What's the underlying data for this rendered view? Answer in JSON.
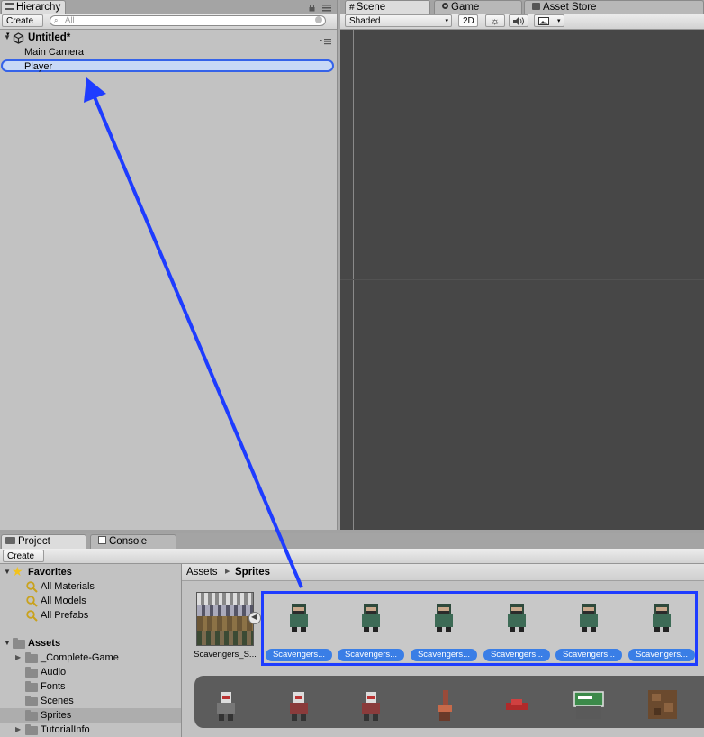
{
  "hierarchy": {
    "tab_label": "Hierarchy",
    "create_label": "Create",
    "search_placeholder": "All",
    "scene_name": "Untitled*",
    "items": [
      "Main Camera",
      "Player"
    ]
  },
  "scene_view": {
    "tabs": [
      "Scene",
      "Game",
      "Asset Store"
    ],
    "shading_mode": "Shaded",
    "mode_2d": "2D"
  },
  "project": {
    "tabs": [
      "Project",
      "Console"
    ],
    "create_label": "Create",
    "favorites_label": "Favorites",
    "favorites": [
      "All Materials",
      "All Models",
      "All Prefabs"
    ],
    "assets_label": "Assets",
    "folders": [
      "_Complete-Game",
      "Audio",
      "Fonts",
      "Scenes",
      "Sprites",
      "TutorialInfo"
    ],
    "breadcrumb": [
      "Assets",
      "Sprites"
    ],
    "sheet_label": "Scavengers_S...",
    "sprite_labels": [
      "Scavengers...",
      "Scavengers...",
      "Scavengers...",
      "Scavengers...",
      "Scavengers...",
      "Scavengers..."
    ]
  },
  "colors": {
    "annotation_blue": "#1e3cff",
    "selection_blue": "#3a7ee6",
    "scene_bg": "#474747"
  },
  "icons": [
    "unity-icon",
    "lock-icon",
    "menu-icon",
    "search-icon",
    "sun-icon",
    "speaker-icon",
    "image-icon",
    "folder-icon",
    "star-icon",
    "magnifier-icon",
    "play-icon"
  ]
}
